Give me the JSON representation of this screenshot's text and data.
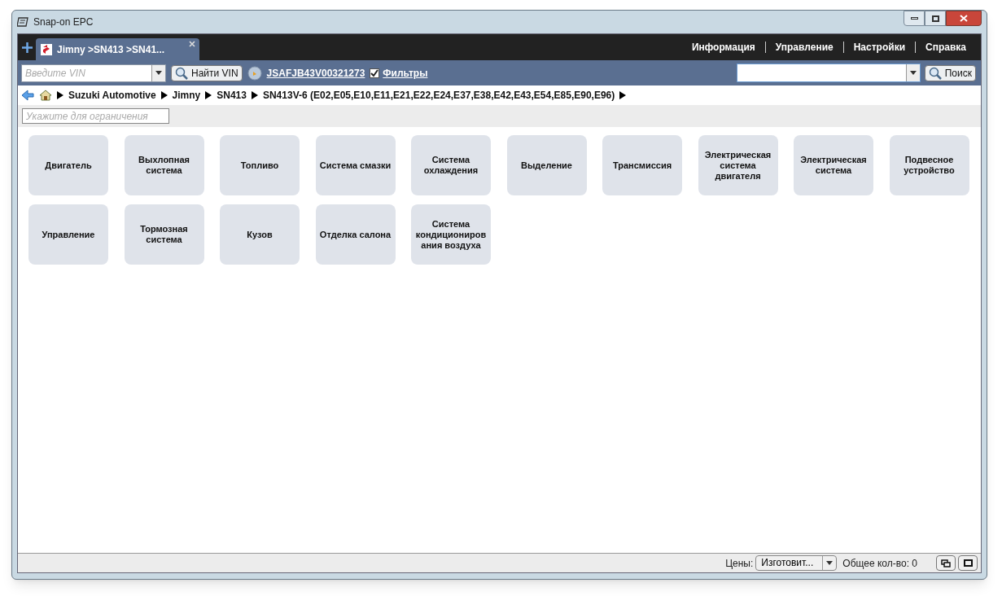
{
  "window": {
    "title": "Snap-on EPC"
  },
  "tabs": [
    {
      "label": "Jimny >SN413 >SN41...",
      "selected": true
    }
  ],
  "menu": [
    "Информация",
    "Управление",
    "Настройки",
    "Справка"
  ],
  "toolbar": {
    "vin_placeholder": "Введите VIN",
    "find_vin": "Найти VIN",
    "vin_link": "JSAFJB43V00321273",
    "filters": {
      "label": "Фильтры",
      "checked": true
    },
    "search_button": "Поиск"
  },
  "breadcrumb": [
    "Suzuki Automotive",
    "Jimny",
    "SN413",
    "SN413V-6 (E02,E05,E10,E11,E21,E22,E24,E37,E38,E42,E43,E54,E85,E90,E96)"
  ],
  "filter": {
    "placeholder": "Укажите для ограничения"
  },
  "categories": [
    "Двигатель",
    "Выхлопная система",
    "Топливо",
    "Система смазки",
    "Система охлаждения",
    "Выделение",
    "Трансмиссия",
    "Электрическая система двигателя",
    "Электрическая система",
    "Подвесное устройство",
    "Управление",
    "Тормозная система",
    "Кузов",
    "Отделка салона",
    "Система кондиционирования воздуха"
  ],
  "status_bar": {
    "prices_label": "Цены:",
    "prices_value": "Изготовит...",
    "total": "Общее кол-во: 0"
  }
}
